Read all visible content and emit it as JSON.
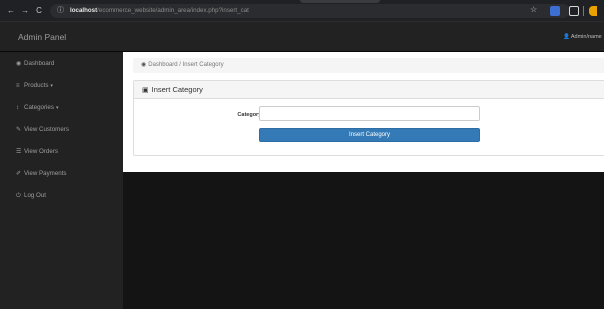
{
  "browser": {
    "back_icon": "←",
    "forward_icon": "→",
    "reload_icon": "C",
    "info_icon": "ⓘ",
    "url_host": "localhost",
    "url_path": "/ecommerce_website/admin_area/index.php?insert_cat",
    "star_icon": "☆"
  },
  "navbar": {
    "brand": "Admin Panel",
    "user_icon": "👤",
    "user_label": "Admin/name"
  },
  "sidebar": {
    "items": [
      {
        "icon": "◉",
        "label": "Dashboard",
        "caret": ""
      },
      {
        "icon": "≡",
        "label": "Products",
        "caret": "▾"
      },
      {
        "icon": "↕",
        "label": "Categories",
        "caret": "▾"
      },
      {
        "icon": "✎",
        "label": "View Customers",
        "caret": ""
      },
      {
        "icon": "☰",
        "label": "View Orders",
        "caret": ""
      },
      {
        "icon": "✐",
        "label": "View Payments",
        "caret": ""
      },
      {
        "icon": "⏻",
        "label": "Log Out",
        "caret": ""
      }
    ]
  },
  "breadcrumb": {
    "icon": "◉",
    "text": "Dashboard / Insert Category"
  },
  "panel": {
    "icon": "▣",
    "title": "Insert Category"
  },
  "form": {
    "label": "Category Title",
    "value": "",
    "submit_label": "Insert Category"
  },
  "colors": {
    "primary": "#337ab7",
    "navbar_bg": "#222222"
  }
}
